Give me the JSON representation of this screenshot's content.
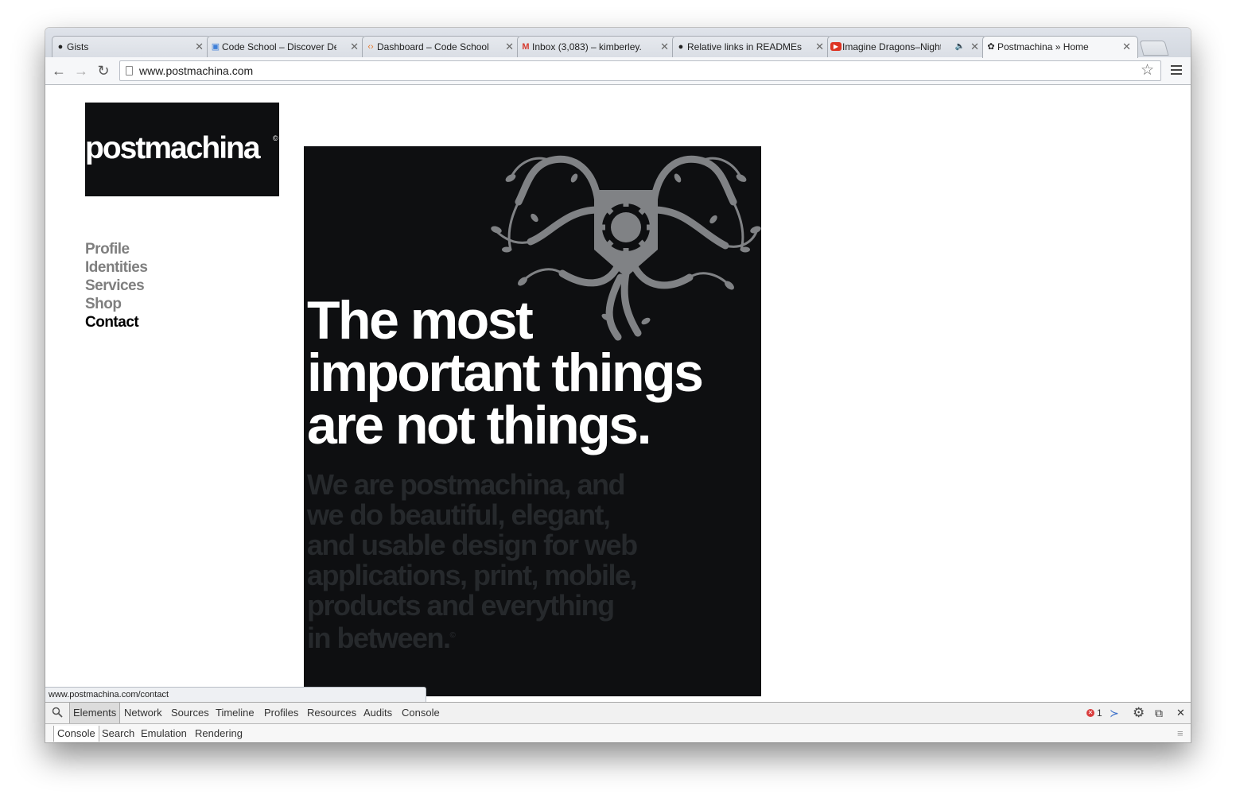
{
  "browser": {
    "tabs": [
      {
        "label": "Gists",
        "icon": "github-icon"
      },
      {
        "label": "Code School – Discover De",
        "icon": "document-icon"
      },
      {
        "label": "Dashboard – Code School",
        "icon": "code-icon"
      },
      {
        "label": "Inbox (3,083) – kimberley.",
        "icon": "gmail-icon"
      },
      {
        "label": "Relative links in READMEs",
        "icon": "github-icon"
      },
      {
        "label": "Imagine Dragons–Night",
        "icon": "youtube-icon"
      },
      {
        "label": "Postmachina » Home",
        "icon": "postmachina-favicon"
      }
    ],
    "url": "www.postmachina.com",
    "status_url": "www.postmachina.com/contact"
  },
  "site": {
    "logo_text": "postmachina",
    "logo_mark": "©",
    "nav": [
      {
        "label": "Profile"
      },
      {
        "label": "Identities"
      },
      {
        "label": "Services"
      },
      {
        "label": "Shop"
      },
      {
        "label": "Contact",
        "current": true
      }
    ],
    "headline": "The most important things are not things.",
    "subtext": "We are postmachina, and we do beautiful, elegant, and usable design for web applications, print, mobile, products and everything in between.",
    "subtext_mark": "©"
  },
  "devtools": {
    "tabs": [
      "Elements",
      "Network",
      "Sources",
      "Timeline",
      "Profiles",
      "Resources",
      "Audits",
      "Console"
    ],
    "selected_tab": "Elements",
    "error_count": "1",
    "drawer_tabs": [
      "Console",
      "Search",
      "Emulation",
      "Rendering"
    ],
    "selected_drawer_tab": "Console"
  },
  "colors": {
    "hero_bg": "#0e0f11",
    "emblem": "#808285",
    "subtext": "#26292c",
    "nav_inactive": "#7f7f7f",
    "nav_active": "#000000"
  }
}
